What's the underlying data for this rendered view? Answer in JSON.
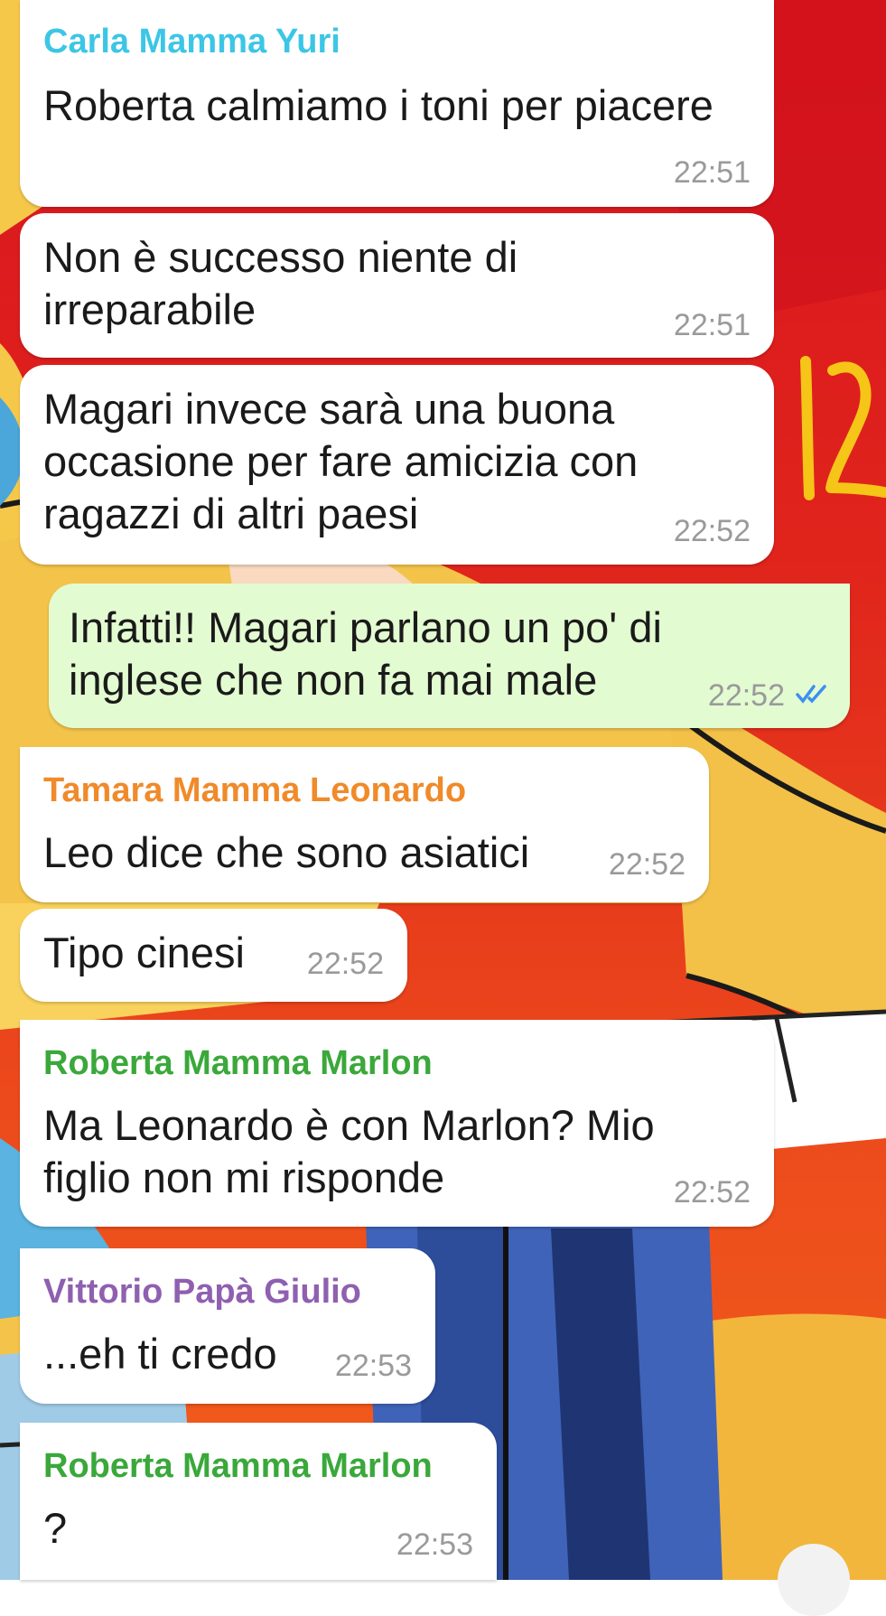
{
  "colors": {
    "incoming_bubble": "#ffffff",
    "outgoing_bubble": "#e3fbd1",
    "time": "#9a9a9a",
    "read_ticks": "#3b8ff0",
    "annotation": "#f5c518",
    "senders": {
      "carla": "#3cc6e6",
      "tamara": "#f08a2a",
      "roberta": "#3aa83a",
      "vittorio": "#8f5fb0"
    }
  },
  "annotation_icon": "hand-drawn-number",
  "messages": [
    {
      "sender": "Carla Mamma Yuri",
      "text": "Roberta calmiamo i toni per piacere",
      "time": "22:51"
    },
    {
      "text": "Non è successo niente di\nirreparabile",
      "time": "22:51"
    },
    {
      "text": "Magari invece sarà una buona\noccasione per fare amicizia con\nragazzi di altri paesi",
      "time": "22:52"
    },
    {
      "text": "Infatti!! Magari parlano un po' di\ninglese che non fa mai male",
      "time": "22:52",
      "status_icon": "double-check-icon"
    },
    {
      "sender": "Tamara Mamma Leonardo",
      "text": "Leo dice che sono asiatici",
      "time": "22:52"
    },
    {
      "text": "Tipo cinesi",
      "time": "22:52"
    },
    {
      "sender": "Roberta Mamma Marlon",
      "text": "Ma Leonardo è con Marlon? Mio\nfiglio non mi risponde",
      "time": "22:52"
    },
    {
      "sender": "Vittorio Papà Giulio",
      "text": "...eh ti credo",
      "time": "22:53"
    },
    {
      "sender": "Roberta Mamma Marlon",
      "text": "?",
      "time": "22:53"
    }
  ]
}
